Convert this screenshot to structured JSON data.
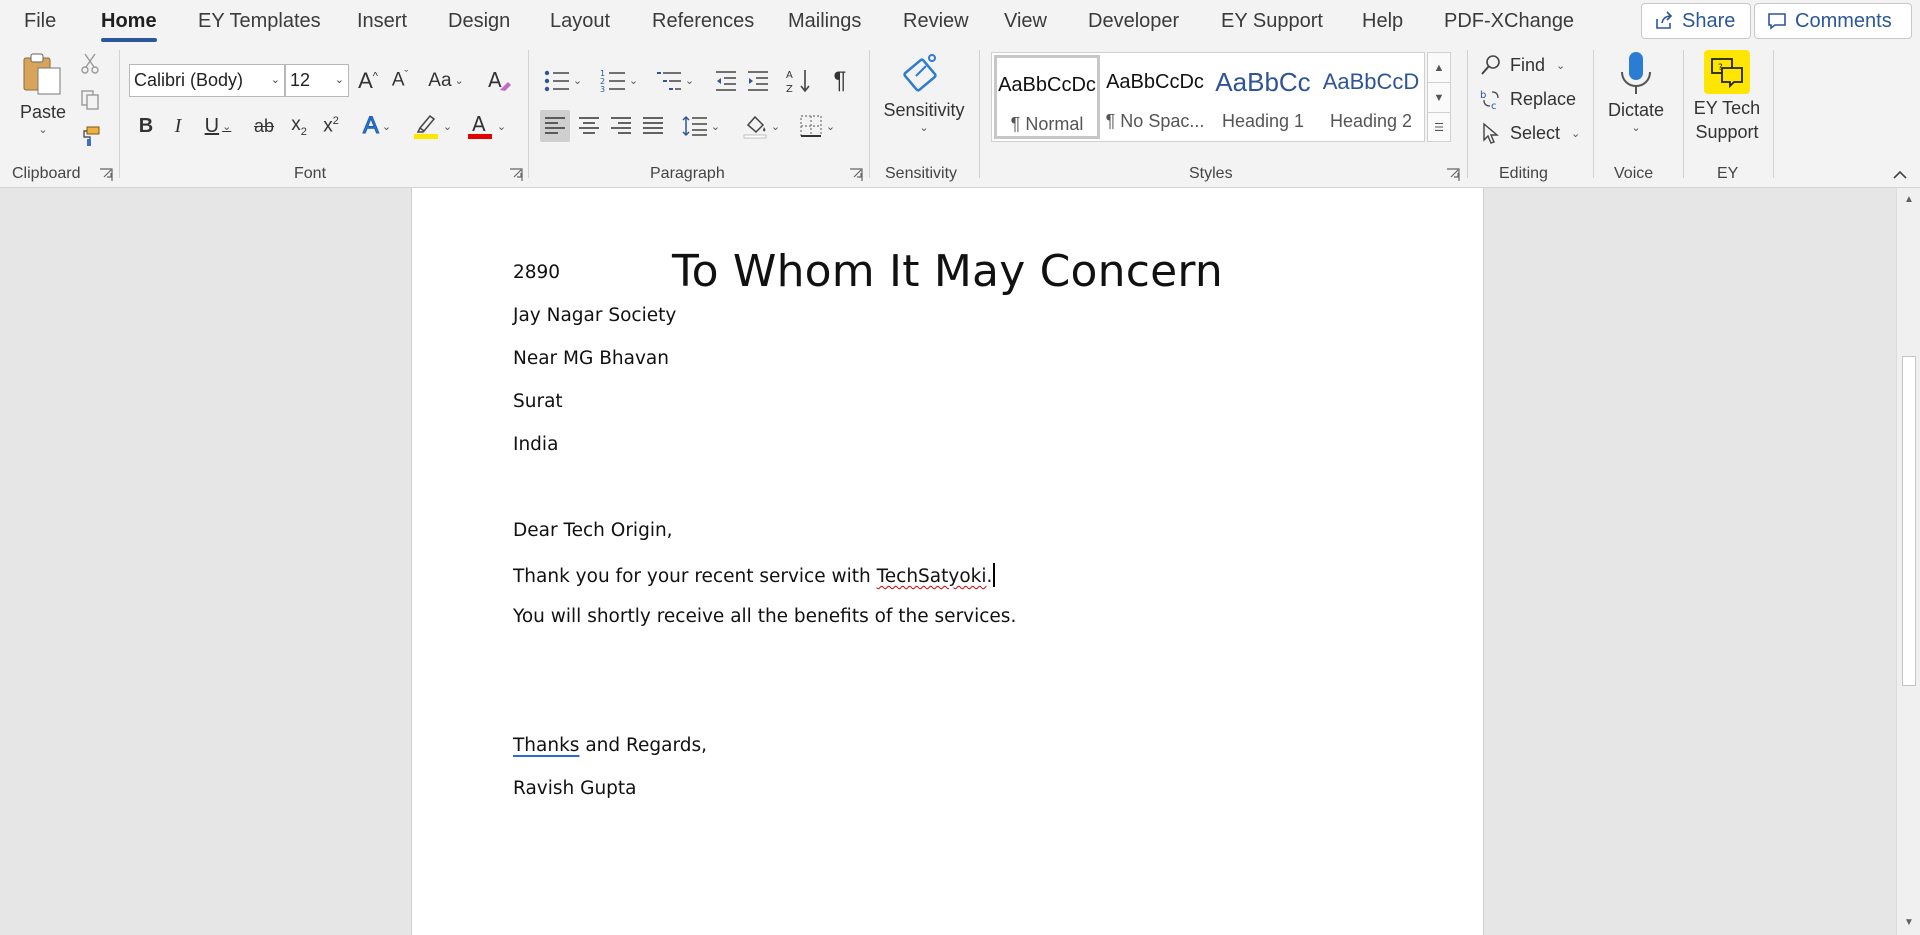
{
  "menu": {
    "tabs": [
      "File",
      "Home",
      "EY Templates",
      "Insert",
      "Design",
      "Layout",
      "References",
      "Mailings",
      "Review",
      "View",
      "Developer",
      "EY Support",
      "Help",
      "PDF-XChange"
    ],
    "active": "Home",
    "share_label": "Share",
    "comments_label": "Comments"
  },
  "ribbon": {
    "clipboard": {
      "paste_label": "Paste",
      "group_label": "Clipboard"
    },
    "font": {
      "font_name": "Calibri (Body)",
      "font_size": "12",
      "group_label": "Font"
    },
    "paragraph": {
      "group_label": "Paragraph"
    },
    "sensitivity": {
      "button_label": "Sensitivity",
      "group_label": "Sensitivity"
    },
    "styles": {
      "group_label": "Styles",
      "items": [
        {
          "preview": "AaBbCcDc",
          "name": "¶ Normal"
        },
        {
          "preview": "AaBbCcDc",
          "name": "¶ No Spac..."
        },
        {
          "preview": "AaBbCc",
          "name": "Heading 1"
        },
        {
          "preview": "AaBbCcD",
          "name": "Heading 2"
        }
      ]
    },
    "editing": {
      "find_label": "Find",
      "replace_label": "Replace",
      "select_label": "Select",
      "group_label": "Editing"
    },
    "voice": {
      "dictate_label": "Dictate",
      "group_label": "Voice"
    },
    "ey": {
      "line1": "EY Tech",
      "line2": "Support",
      "group_label": "EY"
    }
  },
  "document": {
    "title": "To Whom It May Concern",
    "address": [
      "2890",
      "Jay Nagar Society",
      "Near MG Bhavan",
      "Surat",
      "India"
    ],
    "greeting": "Dear Tech Origin,",
    "body1_prefix": "Thank you for your recent service with ",
    "body1_misspelled": "TechSatyoki",
    "body1_suffix": ".",
    "body2": "You will shortly receive all the benefits of the services.",
    "closing_word": "Thanks",
    "closing_rest": " and Regards,",
    "signature": "Ravish Gupta"
  },
  "colors": {
    "accent": "#2b579a",
    "font_color": "#e00000",
    "highlight": "#ffe600",
    "ey_yellow": "#ffe600"
  }
}
